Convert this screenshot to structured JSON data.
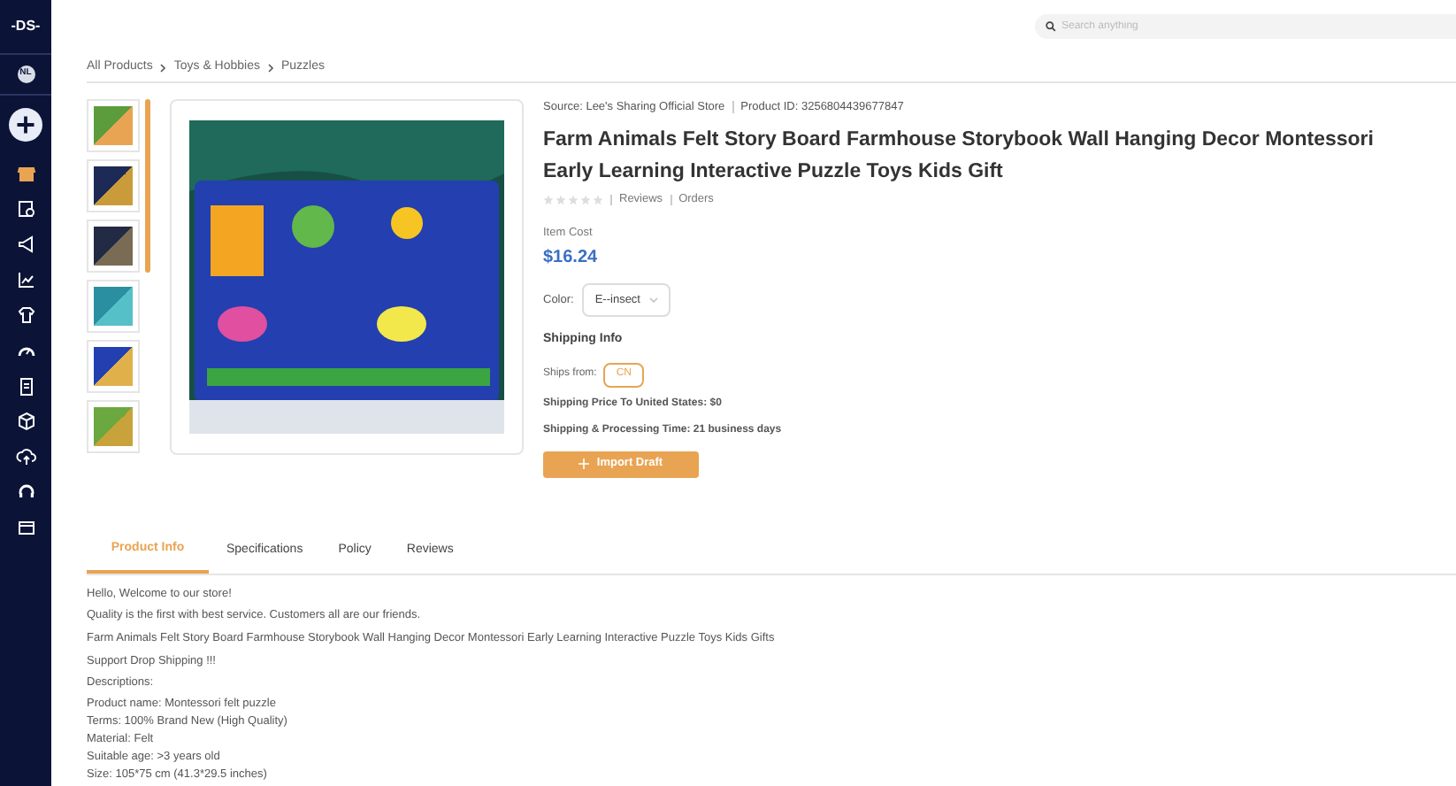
{
  "sidebar": {
    "logo": "-DS-",
    "avatar": "NL",
    "items": [
      {
        "kind": "add"
      },
      {
        "kind": "store"
      },
      {
        "kind": "search-doc"
      },
      {
        "kind": "megaphone"
      },
      {
        "kind": "chart"
      },
      {
        "kind": "shirt"
      },
      {
        "kind": "gauge"
      },
      {
        "kind": "clipboard"
      },
      {
        "kind": "box"
      },
      {
        "kind": "upload"
      },
      {
        "kind": "headset"
      },
      {
        "kind": "mail"
      }
    ]
  },
  "search": {
    "placeholder": "Search anything"
  },
  "breadcrumb": [
    "All Products",
    "Toys & Hobbies",
    "Puzzles"
  ],
  "gallery": {
    "thumbnails": [
      {
        "selected": false
      },
      {
        "selected": false
      },
      {
        "selected": false
      },
      {
        "selected": false
      },
      {
        "selected": false
      },
      {
        "selected": false
      }
    ]
  },
  "product": {
    "source": "Source: Lee's Sharing Official Store",
    "product_id": "Product ID: 3256804439677847",
    "title": "Farm Animals Felt Story Board Farmhouse Storybook Wall Hanging Decor Montessori Early Learning Interactive Puzzle Toys Kids Gift",
    "stars": 0,
    "reviews": "Reviews",
    "orders": "Orders",
    "cost_label": "Item Cost",
    "price": "$16.24",
    "color_label": "Color:",
    "color_value": "E--insect",
    "shipping_heading": "Shipping Info",
    "ships_from_label": "Ships from:",
    "ships_from_value": "CN",
    "shipping_price": "Shipping Price To United States:  $0",
    "processing_time": "Shipping & Processing Time:  21 business days",
    "import_button": "Import Draft"
  },
  "tabs": [
    {
      "label": "Product Info",
      "selected": true
    },
    {
      "label": "Specifications",
      "selected": false
    },
    {
      "label": "Policy",
      "selected": false
    },
    {
      "label": "Reviews",
      "selected": false
    }
  ],
  "description": {
    "paragraphs": [
      "Hello, Welcome to our store!",
      "Quality is the first with best service. Customers all are our friends.",
      "Farm Animals Felt Story Board Farmhouse Storybook Wall Hanging Decor Montessori Early Learning Interactive Puzzle Toys Kids Gifts",
      "Support Drop Shipping !!!",
      "Descriptions:"
    ],
    "details": [
      "Product name: Montessori felt puzzle",
      "Terms: 100% Brand New (High Quality)",
      "Material: Felt",
      "Suitable age: >3 years old",
      "Size: 105*75 cm (41.3*29.5 inches)"
    ]
  }
}
